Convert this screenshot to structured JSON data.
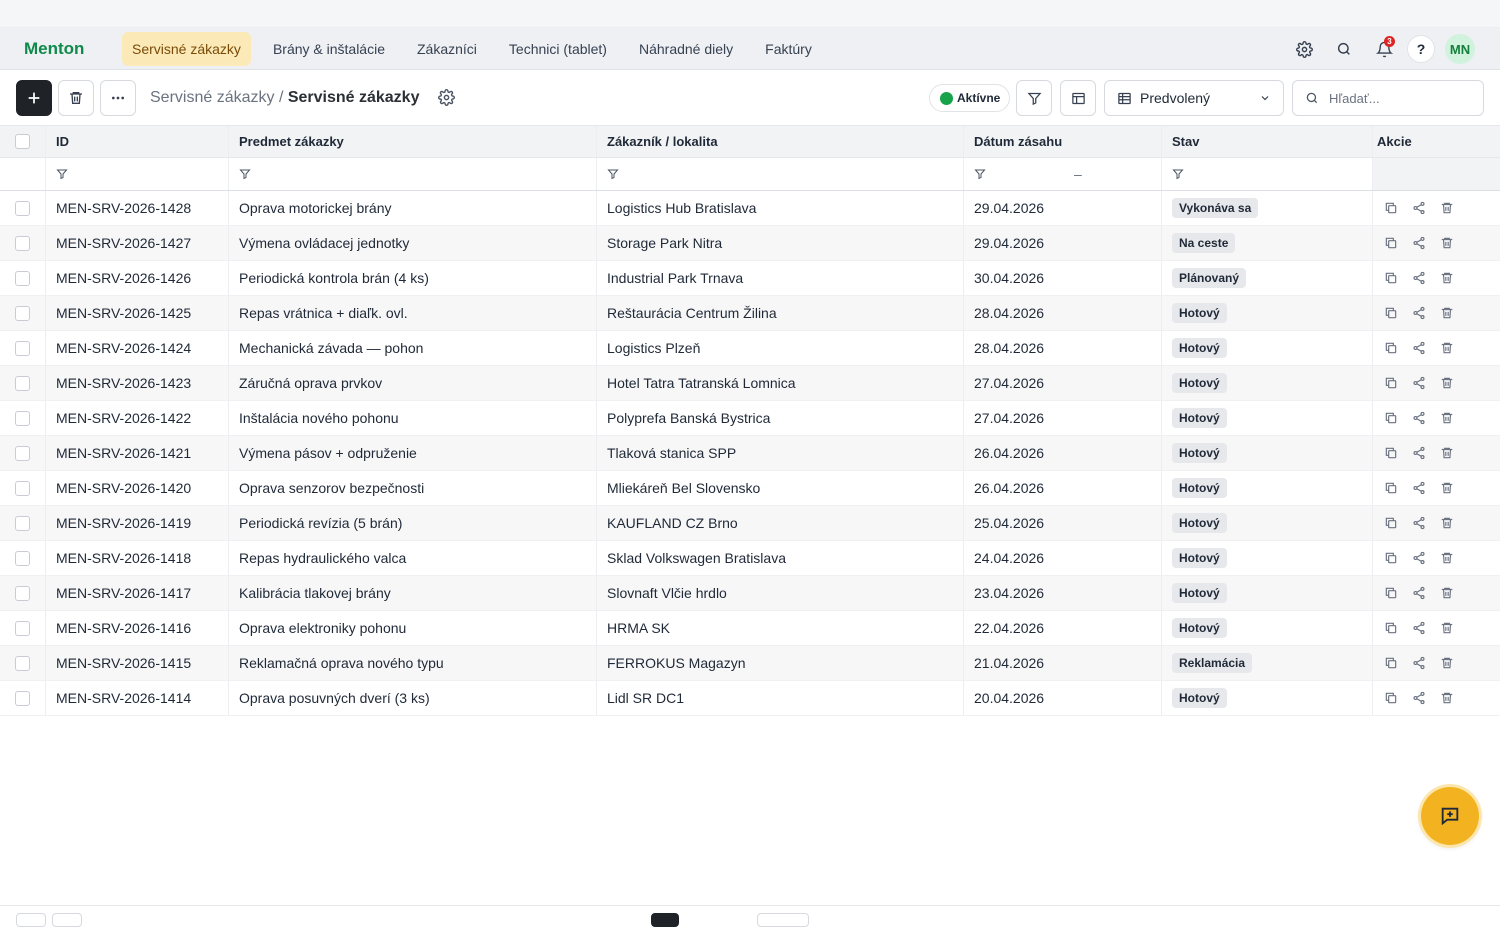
{
  "app": {
    "brand": "Menton"
  },
  "nav": {
    "tabs": [
      {
        "label": "Servisné zákazky",
        "active": true
      },
      {
        "label": "Brány & inštalácie"
      },
      {
        "label": "Zákazníci"
      },
      {
        "label": "Technici (tablet)"
      },
      {
        "label": "Náhradné diely"
      },
      {
        "label": "Faktúry"
      }
    ],
    "notifications_count": "3",
    "help": "?",
    "avatar": "MN"
  },
  "toolbar": {
    "breadcrumb_parent": "Servisné zákazky / ",
    "breadcrumb_current": "Servisné zákazky",
    "status": "Aktívne",
    "view_select": "Predvolený",
    "search_placeholder": "Hľadať..."
  },
  "table": {
    "columns": [
      "ID",
      "Predmet zákazky",
      "Zákazník / lokalita",
      "Dátum zásahu",
      "Stav",
      "Akcie"
    ],
    "date_range_separator": "–",
    "rows": [
      {
        "id": "MEN-SRV-2026-1428",
        "subject": "Oprava motorickej brány",
        "customer": "Logistics Hub Bratislava",
        "date": "29.04.2026",
        "status": "Vykonáva sa"
      },
      {
        "id": "MEN-SRV-2026-1427",
        "subject": "Výmena ovládacej jednotky",
        "customer": "Storage Park Nitra",
        "date": "29.04.2026",
        "status": "Na ceste"
      },
      {
        "id": "MEN-SRV-2026-1426",
        "subject": "Periodická kontrola brán (4 ks)",
        "customer": "Industrial Park Trnava",
        "date": "30.04.2026",
        "status": "Plánovaný"
      },
      {
        "id": "MEN-SRV-2026-1425",
        "subject": "Repas vrátnica + diaľk. ovl.",
        "customer": "Reštaurácia Centrum Žilina",
        "date": "28.04.2026",
        "status": "Hotový"
      },
      {
        "id": "MEN-SRV-2026-1424",
        "subject": "Mechanická závada — pohon",
        "customer": "Logistics Plzeň",
        "date": "28.04.2026",
        "status": "Hotový"
      },
      {
        "id": "MEN-SRV-2026-1423",
        "subject": "Záručná oprava prvkov",
        "customer": "Hotel Tatra Tatranská Lomnica",
        "date": "27.04.2026",
        "status": "Hotový"
      },
      {
        "id": "MEN-SRV-2026-1422",
        "subject": "Inštalácia nového pohonu",
        "customer": "Polyprefa Banská Bystrica",
        "date": "27.04.2026",
        "status": "Hotový"
      },
      {
        "id": "MEN-SRV-2026-1421",
        "subject": "Výmena pásov + odpruženie",
        "customer": "Tlaková stanica SPP",
        "date": "26.04.2026",
        "status": "Hotový"
      },
      {
        "id": "MEN-SRV-2026-1420",
        "subject": "Oprava senzorov bezpečnosti",
        "customer": "Mliekáreň Bel Slovensko",
        "date": "26.04.2026",
        "status": "Hotový"
      },
      {
        "id": "MEN-SRV-2026-1419",
        "subject": "Periodická revízia (5 brán)",
        "customer": "KAUFLAND CZ Brno",
        "date": "25.04.2026",
        "status": "Hotový"
      },
      {
        "id": "MEN-SRV-2026-1418",
        "subject": "Repas hydraulického valca",
        "customer": "Sklad Volkswagen Bratislava",
        "date": "24.04.2026",
        "status": "Hotový"
      },
      {
        "id": "MEN-SRV-2026-1417",
        "subject": "Kalibrácia tlakovej brány",
        "customer": "Slovnaft Vlčie hrdlo",
        "date": "23.04.2026",
        "status": "Hotový"
      },
      {
        "id": "MEN-SRV-2026-1416",
        "subject": "Oprava elektroniky pohonu",
        "customer": "HRMA SK",
        "date": "22.04.2026",
        "status": "Hotový"
      },
      {
        "id": "MEN-SRV-2026-1415",
        "subject": "Reklamačná oprava nového typu",
        "customer": "FERROKUS Magazyn",
        "date": "21.04.2026",
        "status": "Reklamácia"
      },
      {
        "id": "MEN-SRV-2026-1414",
        "subject": "Oprava posuvných dverí (3 ks)",
        "customer": "Lidl SR DC1",
        "date": "20.04.2026",
        "status": "Hotový"
      }
    ]
  },
  "colors": {
    "brand": "#0f8a4b",
    "active_tab_bg": "#fbeab8",
    "fab": "#f3b320",
    "status_dot": "#16a34a"
  },
  "icons": [
    "plus-icon",
    "trash-icon",
    "more-icon",
    "gear-icon",
    "search-icon",
    "bell-icon",
    "filter-icon",
    "columns-icon",
    "table-icon",
    "chevron-down-icon",
    "copy-icon",
    "share-icon",
    "chat-icon"
  ]
}
